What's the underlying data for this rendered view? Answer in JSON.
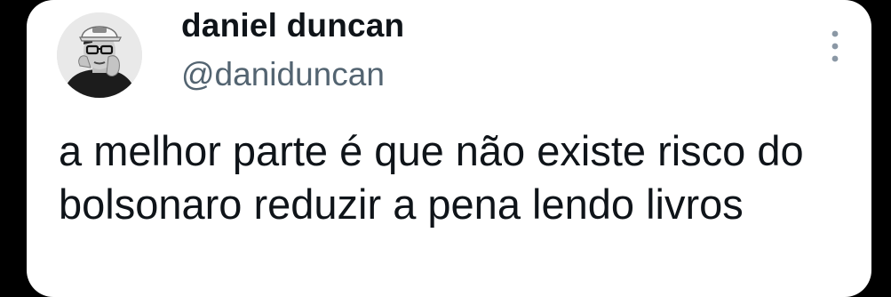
{
  "tweet": {
    "author_name": "daniel duncan",
    "author_handle": "@daniduncan",
    "text": "a melhor parte é que não existe risco do bolsonaro reduzir a pena lendo livros"
  },
  "icons": {
    "avatar": "profile-photo-avatar",
    "more": "more-vertical-icon"
  },
  "colors": {
    "background": "#000000",
    "card": "#ffffff",
    "primary_text": "#0f1419",
    "secondary_text": "#536471"
  }
}
